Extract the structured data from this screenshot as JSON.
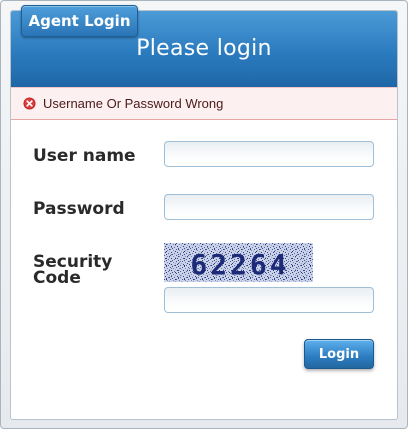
{
  "header": {
    "agent_tab_label": "Agent Login",
    "title": "Please login"
  },
  "error": {
    "message": "Username Or Password Wrong",
    "icon": "error-circle-x-icon",
    "color": "#c62828"
  },
  "form": {
    "username": {
      "label": "User name",
      "value": ""
    },
    "password": {
      "label": "Password",
      "value": ""
    },
    "security_code": {
      "label_line1": "Security",
      "label_line2": "Code",
      "captcha_text": "62264",
      "value": ""
    },
    "submit_label": "Login"
  },
  "colors": {
    "accent": "#2b7bbf",
    "error_background": "#fdf0f0"
  }
}
